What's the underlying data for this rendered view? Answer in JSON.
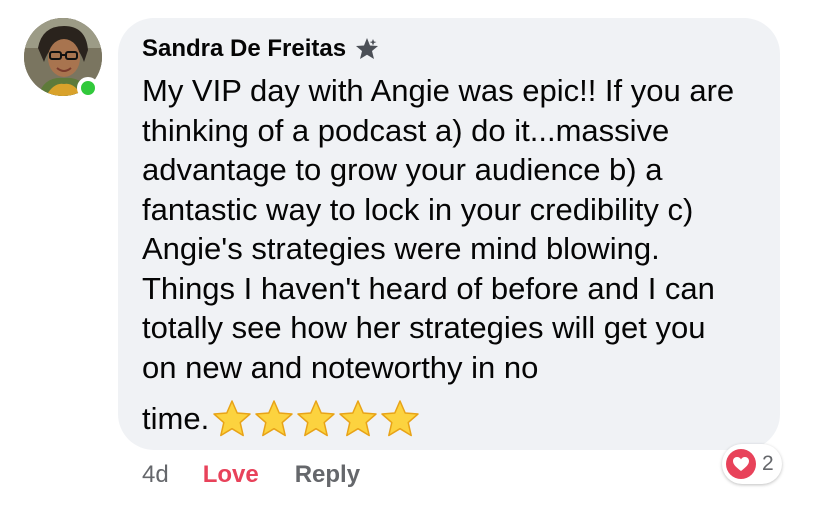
{
  "comment": {
    "author": "Sandra De Freitas",
    "lines": [
      "My VIP day with Angie was epic!! If you are",
      "thinking of a podcast a) do it...massive",
      "advantage to grow your audience b) a",
      "fantastic way to lock in your credibility c)",
      "Angie's strategies were mind blowing.",
      "Things I haven't heard of before and I can",
      "totally see how her strategies will get you",
      "on new and noteworthy in no"
    ],
    "last_word": "time.",
    "star_emoji_count": 5
  },
  "actions": {
    "time": "4d",
    "love": "Love",
    "reply": "Reply"
  },
  "reactions": {
    "icon": "heart-icon",
    "count": "2",
    "color": "#e8425a"
  },
  "status": {
    "online_color": "#31c93b"
  }
}
